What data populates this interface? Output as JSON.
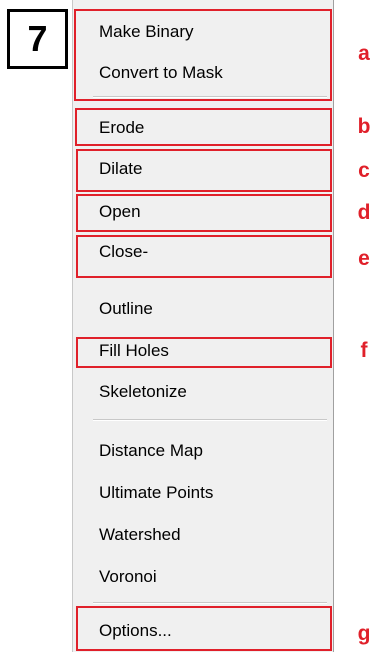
{
  "panel_label": "7",
  "menu": {
    "items": [
      {
        "label": "Make Binary"
      },
      {
        "label": "Convert to Mask"
      },
      {
        "label": "Erode"
      },
      {
        "label": "Dilate"
      },
      {
        "label": "Open"
      },
      {
        "label": "Close-"
      },
      {
        "label": "Outline"
      },
      {
        "label": "Fill Holes"
      },
      {
        "label": "Skeletonize"
      },
      {
        "label": "Distance Map"
      },
      {
        "label": "Ultimate Points"
      },
      {
        "label": "Watershed"
      },
      {
        "label": "Voronoi"
      },
      {
        "label": "Options..."
      }
    ]
  },
  "annotations": {
    "letters": [
      "a",
      "b",
      "c",
      "d",
      "e",
      "f",
      "g"
    ],
    "color": "#e0202a"
  }
}
